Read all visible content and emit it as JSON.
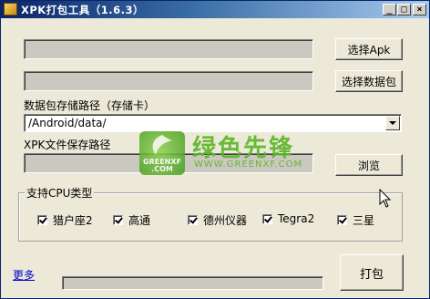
{
  "window": {
    "title": "XPK打包工具（1.6.3）",
    "min_glyph": "_",
    "max_glyph": "□",
    "close_glyph": "×"
  },
  "apk_path": {
    "value": ""
  },
  "data_pack_path": {
    "value": ""
  },
  "buttons": {
    "select_apk": "选择Apk",
    "select_data": "选择数据包",
    "browse": "浏览",
    "pack": "打包"
  },
  "labels": {
    "data_path": "数据包存储路径（存储卡）",
    "xpk_path": "XPK文件保存路径"
  },
  "data_path_select": {
    "selected": "/Android/data/"
  },
  "xpk_save_path": {
    "value": ""
  },
  "cpu_group": {
    "title": "支持CPU类型",
    "options": [
      {
        "label": "猎户座2",
        "checked": true
      },
      {
        "label": "高通",
        "checked": true
      },
      {
        "label": "德州仪器",
        "checked": true
      },
      {
        "label": "Tegra2",
        "checked": true
      },
      {
        "label": "三星",
        "checked": true
      }
    ]
  },
  "more_link": "更多",
  "progress": {
    "value": 0
  },
  "watermark": {
    "logo_text": "GREENXF\n.COM",
    "brand": "绿色先锋",
    "url": "WWW.GREENXF.COM"
  }
}
